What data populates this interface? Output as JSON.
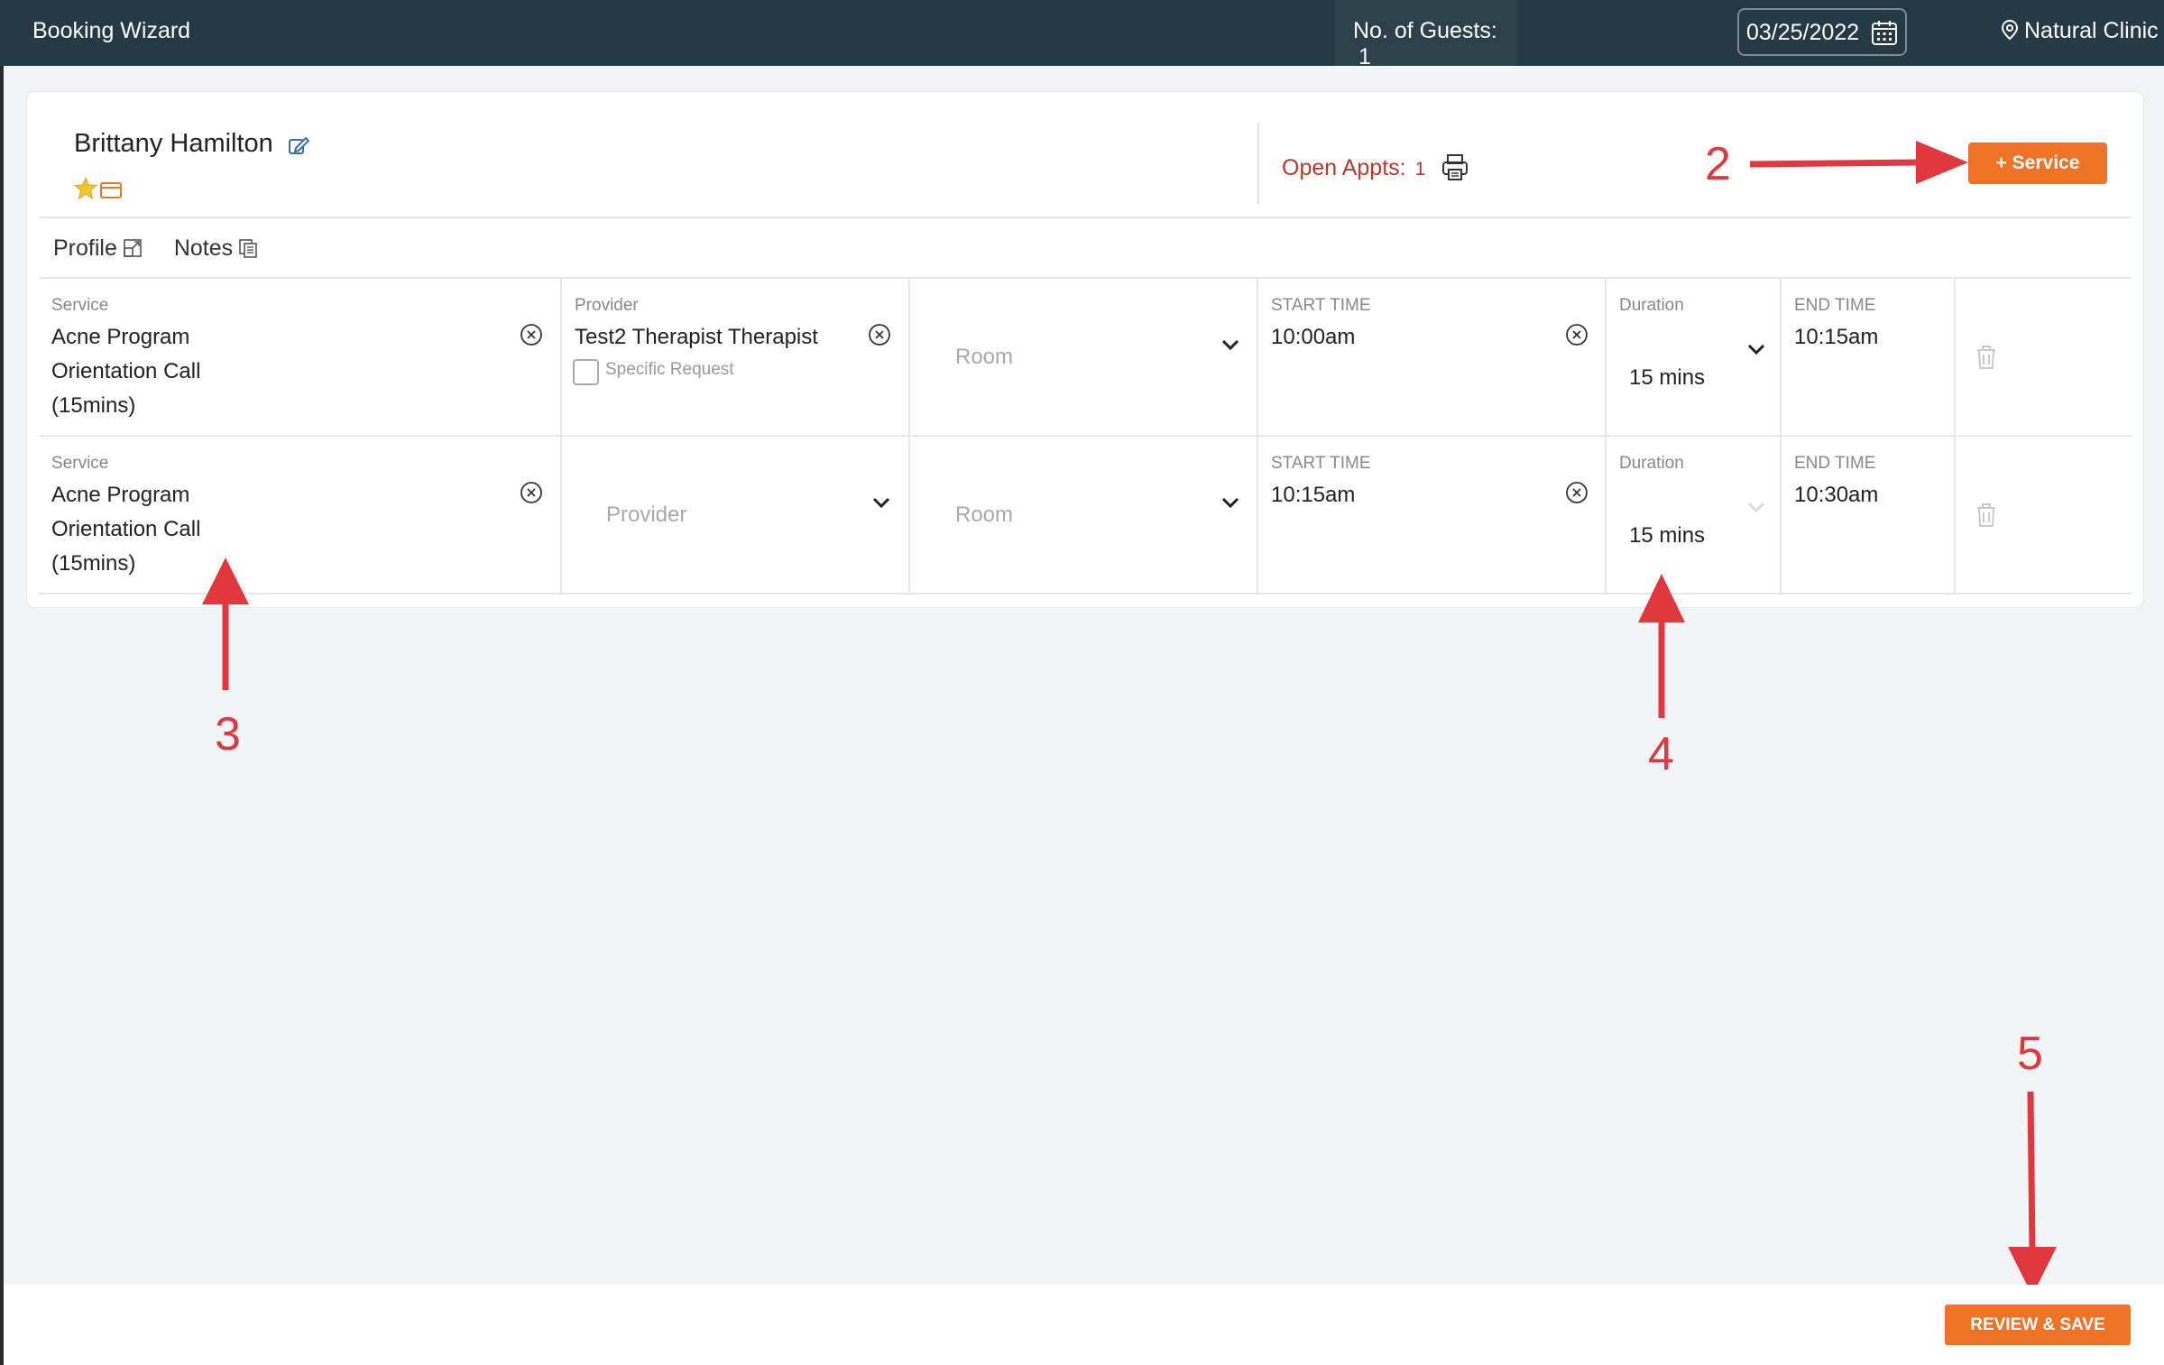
{
  "topbar": {
    "title": "Booking Wizard",
    "guests_label": "No. of Guests:",
    "guests_count": "1",
    "date": "03/25/2022",
    "location": "Natural Clinic"
  },
  "guest": {
    "name": "Brittany Hamilton",
    "open_appts_label": "Open Appts:",
    "open_appts_count": "1",
    "add_service_label": "+ Service"
  },
  "tabs": {
    "profile": "Profile",
    "notes": "Notes"
  },
  "rows": [
    {
      "service_label": "Service",
      "service_lines": [
        "Acne Program",
        "Orientation Call",
        "(15mins)"
      ],
      "provider_label": "Provider",
      "provider_value": "Test2 Therapist Therapist",
      "specific_request": "Specific Request",
      "room_placeholder": "Room",
      "start_label": "START TIME",
      "start_value": "10:00am",
      "duration_label": "Duration",
      "duration_value": "15 mins",
      "end_label": "END TIME",
      "end_value": "10:15am"
    },
    {
      "service_label": "Service",
      "service_lines": [
        "Acne Program",
        "Orientation Call",
        "(15mins)"
      ],
      "provider_placeholder": "Provider",
      "room_placeholder": "Room",
      "start_label": "START TIME",
      "start_value": "10:15am",
      "duration_label": "Duration",
      "duration_value": "15 mins",
      "end_label": "END TIME",
      "end_value": "10:30am"
    }
  ],
  "annotations": [
    "2",
    "3",
    "4",
    "5"
  ],
  "footer": {
    "review_label": "REVIEW & SAVE"
  },
  "colors": {
    "topbar": "#263a45",
    "accent": "#ee7327",
    "annotation": "#e0383e",
    "open_appts": "#b43a2a"
  }
}
